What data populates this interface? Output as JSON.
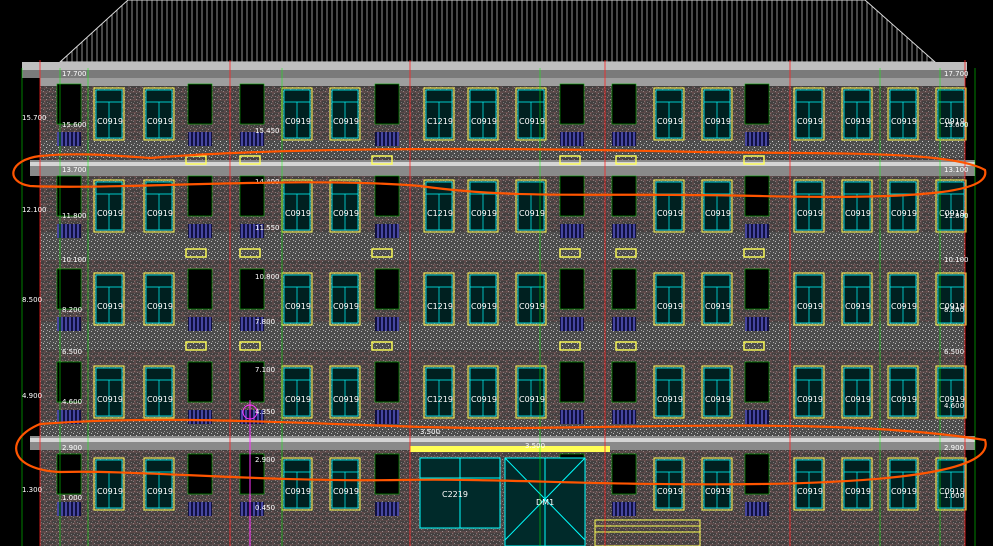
{
  "drawing": {
    "roof_level": "17.700",
    "roof_level_right": "17.700",
    "left_elev_labels": [
      "15.700",
      "12.100",
      "8.500",
      "4.900",
      "1.300"
    ],
    "right_elev_labels": [
      "15.600",
      "13.100",
      "11.800",
      "10.100",
      "8.200",
      "6.500",
      "4.600",
      "2.900",
      "1.000"
    ],
    "inner_elev_labels": [
      "15.600",
      "13.700",
      "11.800",
      "10.100",
      "8.200",
      "6.500",
      "4.600",
      "2.900",
      "1.000"
    ],
    "mid_elev_labels": [
      "15.450",
      "14.400",
      "11.550",
      "10.800",
      "7.800",
      "7.100",
      "4.350",
      "3.500",
      "0.450",
      "3.500",
      "2.900"
    ],
    "window_types": {
      "std": "C0919",
      "wide": "C1219",
      "ground_wide": "C2219",
      "door": "DM1"
    },
    "colors": {
      "background": "#000000",
      "wall_texture": "#7a7a7a",
      "brick": "#a05050",
      "window_frame": "#ffff55",
      "window_glass": "#00ffff",
      "grid_line": "#ff2020",
      "green_line": "#00ff00",
      "annotation_orange": "#ff5500",
      "railing": "#6b6bff"
    }
  }
}
